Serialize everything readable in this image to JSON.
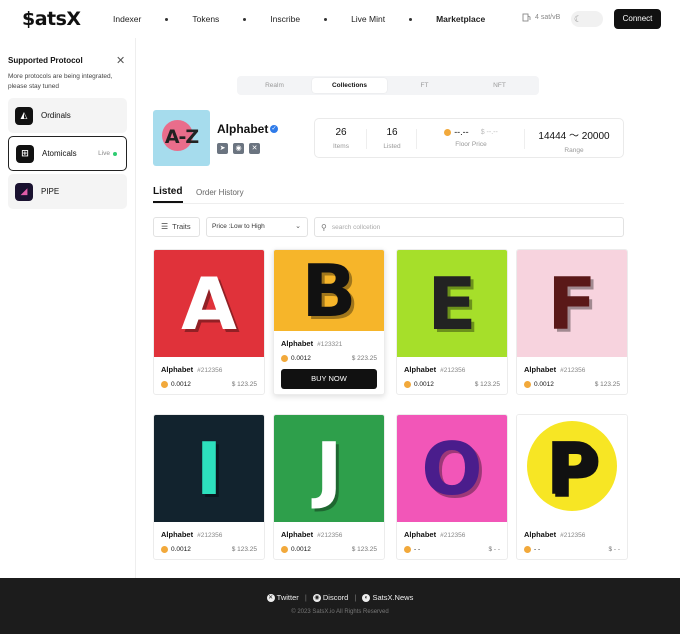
{
  "header": {
    "logo": "$atsX",
    "nav": [
      "Indexer",
      "Tokens",
      "Inscribe",
      "Live Mint",
      "Marketplace"
    ],
    "gas": "4 sat/vB",
    "connect": "Connect"
  },
  "sidebar": {
    "title": "Supported Protocol",
    "description": "More protocols are being integrated, please stay tuned",
    "protocols": [
      {
        "name": "Ordinals",
        "icon": "ordinals-icon"
      },
      {
        "name": "Atomicals",
        "icon": "atomicals-icon",
        "status": "Live"
      },
      {
        "name": "PIPE",
        "icon": "pipe-icon"
      }
    ]
  },
  "tabs": [
    "Realm",
    "Collections",
    "FT",
    "NFT"
  ],
  "collection": {
    "name": "Alphabet",
    "image_text": "A-Z",
    "stats": {
      "items": "26",
      "items_label": "Items",
      "listed": "16",
      "listed_label": "Listed",
      "floor_btc": "--.--",
      "floor_usd": "$ --.--",
      "floor_label": "Floor Price",
      "range": "14444 〜 20000",
      "range_label": "Range"
    }
  },
  "listing_tabs": {
    "listed": "Listed",
    "history": "Order History"
  },
  "filters": {
    "traits": "Traits",
    "sort": "Price :Low to High",
    "search_placeholder": "search collcetion"
  },
  "buy_label": "BUY NOW",
  "cards": [
    {
      "letter": "A",
      "name": "Alphabet",
      "id": "#212356",
      "btc": "0.0012",
      "usd": "$ 123.25",
      "bg": "#e0323a",
      "fg": "#ffffff"
    },
    {
      "letter": "B",
      "name": "Alphabet",
      "id": "#123321",
      "btc": "0.0012",
      "usd": "$ 223.25",
      "bg": "#f6b52a",
      "fg": "#111111"
    },
    {
      "letter": "E",
      "name": "Alphabet",
      "id": "#212356",
      "btc": "0.0012",
      "usd": "$ 123.25",
      "bg": "#a6df2a",
      "fg": "#222222"
    },
    {
      "letter": "F",
      "name": "Alphabet",
      "id": "#212356",
      "btc": "0.0012",
      "usd": "$ 123.25",
      "bg": "#f7d3de",
      "fg": "#5a1818"
    },
    {
      "letter": "I",
      "name": "Alphabet",
      "id": "#212356",
      "btc": "0.0012",
      "usd": "$ 123.25",
      "bg": "#12232e",
      "fg": "#2de0bd"
    },
    {
      "letter": "J",
      "name": "Alphabet",
      "id": "#212356",
      "btc": "0.0012",
      "usd": "$ 123.25",
      "bg": "#2e9f4b",
      "fg": "#ffffff"
    },
    {
      "letter": "O",
      "name": "Alphabet",
      "id": "#212356",
      "btc": "- -",
      "usd": "$ - -",
      "bg": "#f256b8",
      "fg": "#4a1d8c"
    },
    {
      "letter": "P",
      "name": "Alphabet",
      "id": "#212356",
      "btc": "- -",
      "usd": "$ - -",
      "bg": "#ffffff",
      "fg": "#111111"
    }
  ],
  "footer": {
    "links": [
      "Twitter",
      "Discord",
      "SatsX.News"
    ],
    "copyright": "© 2023 SatsX.io All Rights Reserved"
  }
}
